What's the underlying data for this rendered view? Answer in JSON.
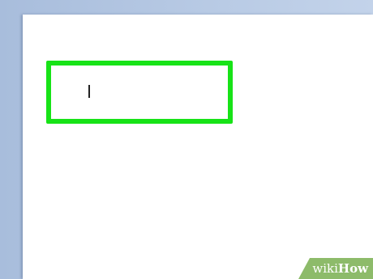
{
  "watermark": {
    "part1": "wiki",
    "part2": "How"
  },
  "colors": {
    "highlight": "#17e317",
    "page": "#ffffff",
    "app_background": "#b3c7e3",
    "watermark_background": "#8dbb6a"
  },
  "icons": {
    "text_cursor": "text-cursor-icon"
  }
}
